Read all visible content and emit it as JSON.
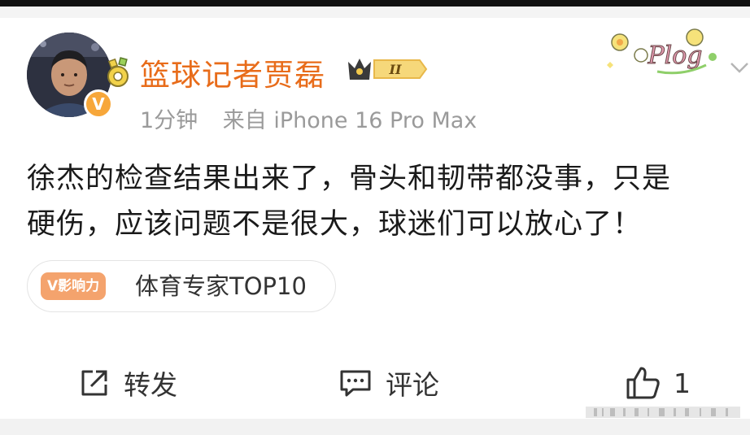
{
  "post": {
    "username": "篮球记者贾磊",
    "level": "II",
    "verified_mark": "V",
    "time": "1分钟",
    "source": "来自 iPhone 16 Pro Max",
    "text": "徐杰的检查结果出来了，骨头和韧带都没事，只是\n硬伤，应该问题不是很大，球迷们可以放心了！",
    "influence_badge": "V影响力",
    "influence_label": "体育专家TOP10",
    "decoration_text": "Plog"
  },
  "actions": {
    "repost_label": "转发",
    "comment_label": "评论",
    "like_count": "1"
  },
  "colors": {
    "username": "#e86c1a",
    "verified": "#f7a73a",
    "badge": "#f4a36d",
    "meta": "#9a9a9a"
  },
  "icons": {
    "repost": "share-square-icon",
    "comment": "comment-box-icon",
    "like": "thumbs-up-icon",
    "more": "chevron-down-icon"
  }
}
